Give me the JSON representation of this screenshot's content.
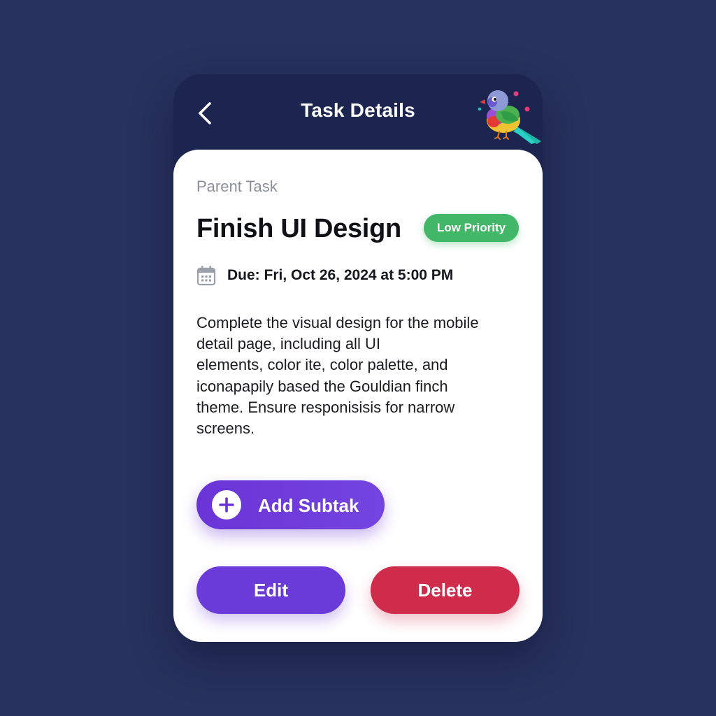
{
  "header": {
    "title": "Task Details",
    "back_icon": "chevron-left-icon",
    "mascot": "gouldian-finch-illustration"
  },
  "task": {
    "parent_label": "Parent Task",
    "title": "Finish UI Design",
    "priority": "Low Priority",
    "due": "Due: Fri, Oct 26, 2024 at 5:00 PM",
    "description_lines": [
      "Complete the visual design for the mobile",
      "detail page, including all UI",
      "elements, color ite, color palette, and",
      "iconapapily based the Gouldian finch",
      "theme. Ensure responisisis for narrow",
      "screens."
    ]
  },
  "actions": {
    "add_subtask": "Add Subtak",
    "edit": "Edit",
    "delete": "Delete"
  },
  "colors": {
    "background": "#27325e",
    "header": "#1c2550",
    "priority_low": "#41b767",
    "primary": "#6a3bd8",
    "danger": "#cf2b4b"
  }
}
